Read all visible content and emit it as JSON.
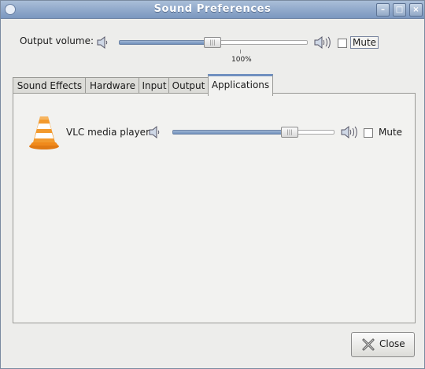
{
  "window": {
    "title": "Sound Preferences"
  },
  "output": {
    "label": "Output volume:",
    "volume_percent": 100,
    "volume_text": "100%",
    "mute_label": "Mute",
    "muted": false
  },
  "tabs": [
    {
      "label": "Sound Effects",
      "active": false
    },
    {
      "label": "Hardware",
      "active": false
    },
    {
      "label": "Input",
      "active": false
    },
    {
      "label": "Output",
      "active": false
    },
    {
      "label": "Applications",
      "active": true
    }
  ],
  "applications": [
    {
      "name": "VLC media player",
      "icon": "vlc-cone-icon",
      "volume_percent": 100,
      "mute_label": "Mute",
      "muted": false
    }
  ],
  "buttons": {
    "close_label": "Close"
  },
  "colors": {
    "titlebar": "#7b97bf",
    "slider_fill": "#7f9cc4",
    "vlc_orange": "#f08a1c"
  }
}
